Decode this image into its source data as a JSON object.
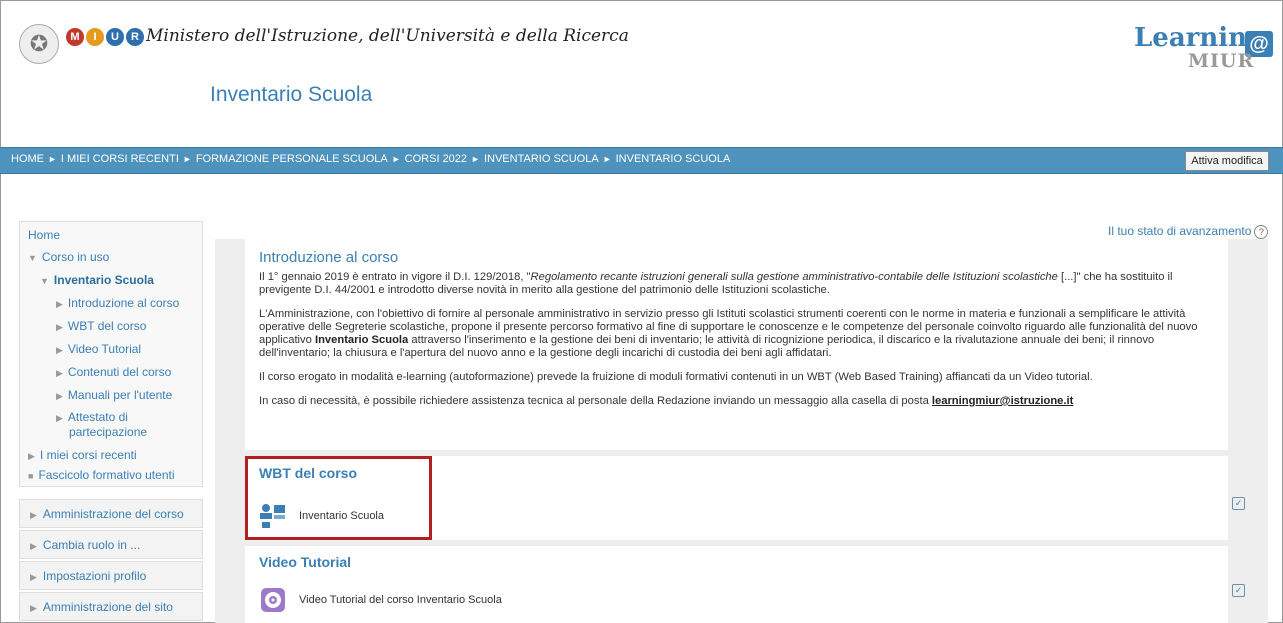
{
  "header": {
    "ministry_name": "Ministero dell'Istruzione, dell'Università e della Ricerca",
    "site_title": "Inventario Scuola",
    "logo_text": "Learning",
    "logo_at": "@",
    "logo_sub": "MIUR",
    "miur_letters": [
      "M",
      "I",
      "U",
      "R"
    ]
  },
  "breadcrumb": {
    "items": [
      "HOME",
      "I MIEI CORSI RECENTI",
      "FORMAZIONE PERSONALE SCUOLA",
      "CORSI 2022",
      "INVENTARIO SCUOLA",
      "INVENTARIO SCUOLA"
    ],
    "separator": "►",
    "edit_button": "Attiva modifica"
  },
  "sidebar": {
    "home": "Home",
    "current_course": "Corso in uso",
    "course": "Inventario Scuola",
    "course_items": [
      "Introduzione al corso",
      "WBT del corso",
      "Video Tutorial",
      "Contenuti del corso",
      "Manuali per l'utente"
    ],
    "attestato_line1": "Attestato di",
    "attestato_line2": "partecipazione",
    "recent": "I miei corsi recenti",
    "fascicolo": "Fascicolo formativo utenti",
    "panels": [
      "Amministrazione del corso",
      "Cambia ruolo in ...",
      "Impostazioni profilo",
      "Amministrazione del sito"
    ]
  },
  "progress": {
    "label": "Il tuo stato di avanzamento",
    "help": "?"
  },
  "intro": {
    "title": "Introduzione al corso",
    "p1_a": "Il 1° gennaio 2019 è entrato in vigore il D.I. 129/2018, \"",
    "p1_italic": "Regolamento recante istruzioni generali sulla gestione amministrativo-contabile delle Istituzioni scolastiche",
    "p1_b": " [...]\" che ha sostituito il previgente D.I. 44/2001 e introdotto diverse novità in merito alla gestione del patrimonio delle Istituzioni scolastiche.",
    "p2_a": "L'Amministrazione, con l'obiettivo di fornire al personale amministrativo in servizio presso gli Istituti scolastici strumenti coerenti con le norme in materia e funzionali a semplificare le attività operative delle Segreterie scolastiche, propone il presente percorso formativo al fine di supportare le conoscenze e le competenze del personale coinvolto riguardo alle funzionalità del nuovo applicativo ",
    "p2_bold": "Inventario Scuola",
    "p2_b": " attraverso l'inserimento e la gestione dei beni di inventario; le attività di ricognizione periodica, il discarico e la rivalutazione annuale dei beni; il rinnovo dell'inventario; la chiusura e l'apertura del nuovo anno e la gestione degli incarichi di custodia dei beni agli affidatari.",
    "p3": "Il corso erogato in modalità e-learning (autoformazione) prevede la fruizione di moduli formativi contenuti in un WBT (Web Based Training) affiancati da un Video tutorial.",
    "p4_a": "In caso di necessità, è possibile richiedere assistenza tecnica al personale della Redazione inviando un messaggio alla casella di posta ",
    "p4_link": "learningmiur@istruzione.it"
  },
  "wbt": {
    "title": "WBT del corso",
    "activity": "Inventario Scuola"
  },
  "video": {
    "title": "Video Tutorial",
    "activity": "Video Tutorial del corso Inventario Scuola"
  },
  "colors": {
    "accent": "#3b7fb5",
    "navbar": "#4d93bd",
    "highlight": "#b02020"
  }
}
